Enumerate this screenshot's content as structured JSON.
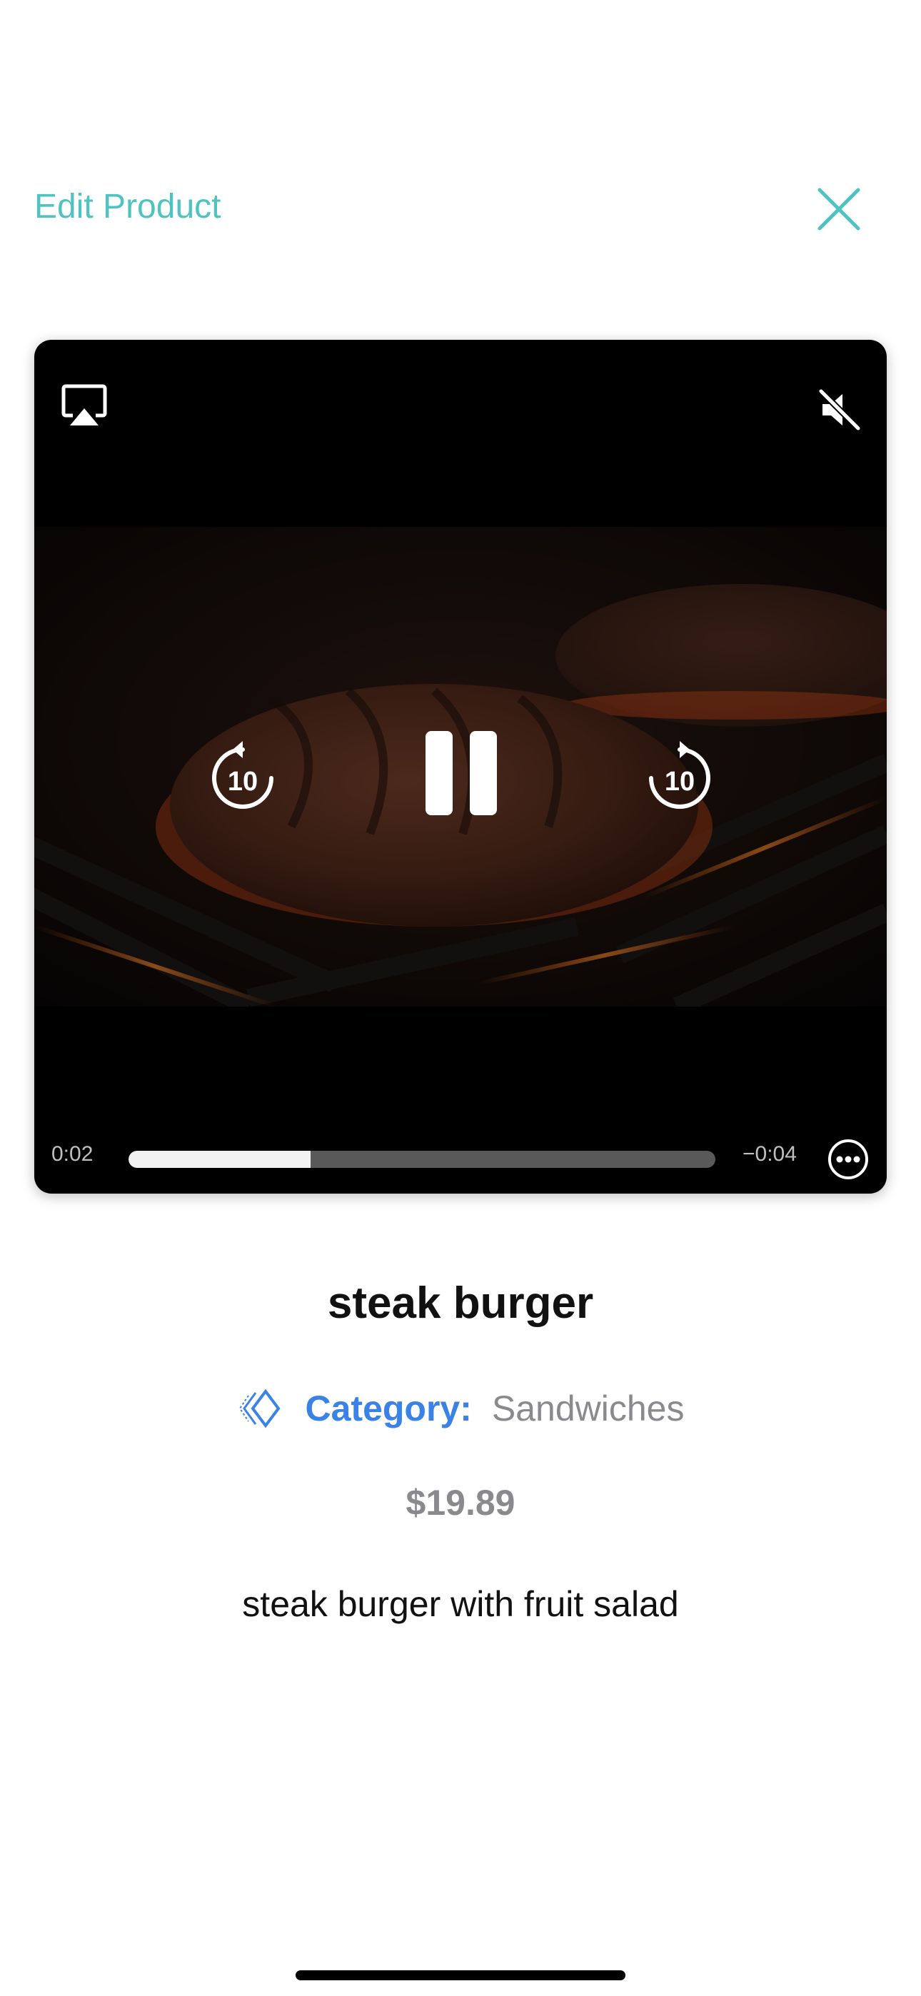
{
  "header": {
    "edit_label": "Edit Product",
    "close_icon": "close-icon",
    "accent_color": "#4fc3c0"
  },
  "player": {
    "icons": {
      "airplay": "airplay-icon",
      "mute": "speaker-muted-icon",
      "skip_back": "skip-back-10-icon",
      "pause": "pause-icon",
      "skip_forward": "skip-forward-10-icon",
      "more": "more-options-icon"
    },
    "skip_back_label": "10",
    "skip_forward_label": "10",
    "elapsed": "0:02",
    "remaining": "−0:04",
    "progress_percent": 31
  },
  "product": {
    "name": "steak burger",
    "category_label": "Category:",
    "category_value": "Sandwiches",
    "category_icon": "category-icon",
    "price": "$19.89",
    "description": "steak burger with fruit salad",
    "label_color": "#3b82e6",
    "muted_color": "#8a8a8e"
  }
}
